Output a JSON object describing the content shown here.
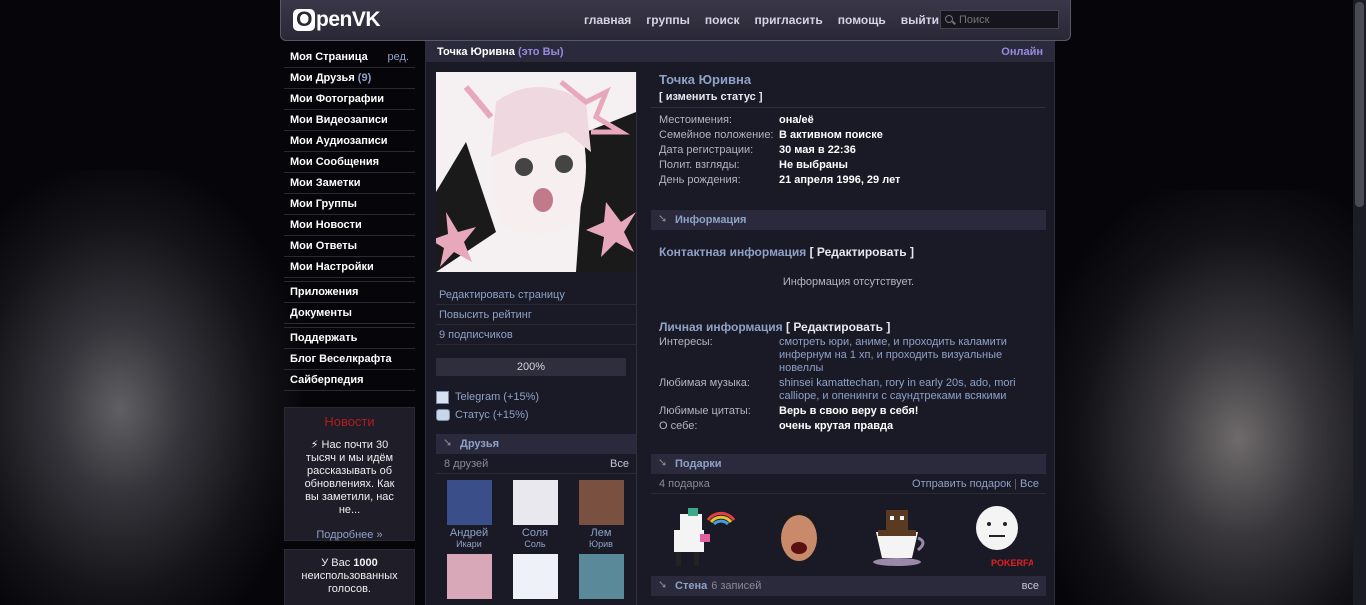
{
  "header": {
    "logo": "penVK",
    "logo_letter": "O",
    "nav": [
      "главная",
      "группы",
      "поиск",
      "пригласить",
      "помощь",
      "выйти"
    ],
    "search_placeholder": "Поиск"
  },
  "sidebar": {
    "items": [
      {
        "label": "Моя Страница",
        "extra": "ред."
      },
      {
        "label": "Мои Друзья",
        "count": "(9)"
      },
      {
        "label": "Мои Фотографии"
      },
      {
        "label": "Мои Видеозаписи"
      },
      {
        "label": "Мои Аудиозаписи"
      },
      {
        "label": "Мои Сообщения"
      },
      {
        "label": "Мои Заметки"
      },
      {
        "label": "Мои Группы"
      },
      {
        "label": "Мои Новости"
      },
      {
        "label": "Мои Ответы"
      },
      {
        "label": "Мои Настройки"
      }
    ],
    "items2": [
      "Приложения",
      "Документы"
    ],
    "items3": [
      "Поддержать",
      "Блог Веселкрафта",
      "Сайберпедия"
    ],
    "news": {
      "title": "Новости",
      "text": "⚡ Нас почти 30 тысяч и мы идём рассказывать об обновлениях. Как вы заметили, нас не...",
      "more": "Подробнее »"
    },
    "votes": {
      "prefix": "У Вас",
      "count": "1000",
      "suffix": "неиспользованных голосов."
    }
  },
  "profile": {
    "top_name": "Точка Юривна",
    "top_you": "(это Вы)",
    "online": "Онлайн",
    "name": "Точка Юривна",
    "status": "[ изменить статус ]",
    "info": [
      {
        "k": "Местоимения:",
        "v": "она/её"
      },
      {
        "k": "Семейное положение:",
        "v": "В активном поиске"
      },
      {
        "k": "Дата регистрации:",
        "v": "30 мая в 22:36"
      },
      {
        "k": "Полит. взгляды:",
        "v": "Не выбраны"
      },
      {
        "k": "День рождения:",
        "v": "21 апреля 1996, 29 лет"
      }
    ],
    "actions": [
      "Редактировать страницу",
      "Повысить рейтинг",
      "9 подписчиков"
    ],
    "rating": "200%",
    "links": [
      "Telegram (+15%)",
      "Статус (+15%)"
    ]
  },
  "friends": {
    "title": "Друзья",
    "count": "8 друзей",
    "all": "Все",
    "list": [
      {
        "first": "Андрей",
        "last": "Икари",
        "color": "#3a4e8a"
      },
      {
        "first": "Соля",
        "last": "Соль",
        "color": "#e8e8ee"
      },
      {
        "first": "Лем",
        "last": "Юрив",
        "color": "#7a5040"
      },
      {
        "first": "",
        "last": "",
        "color": "#d8a8b8"
      },
      {
        "first": "",
        "last": "",
        "color": "#eef2f8"
      },
      {
        "first": "",
        "last": "",
        "color": "#5a8a9a"
      }
    ]
  },
  "information": {
    "header": "Информация",
    "contact_title": "Контактная информация",
    "contact_edit": "[ Редактировать ]",
    "no_info": "Информация отсутствует.",
    "personal_title": "Личная информация",
    "personal_edit": "[ Редактировать ]",
    "personal": [
      {
        "k": "Интересы:",
        "v": "смотреть юри, аниме, и проходить каламити инфернум на 1 хп, и проходить визуальные новеллы",
        "style": "plain"
      },
      {
        "k": "Любимая музыка:",
        "v": "shinsei kamattechan, rory in early 20s, ado, mori calliope, и опенинги с саундтреками всякими",
        "style": "link"
      },
      {
        "k": "Любимые цитаты:",
        "v": "Верь в свою веру в себя!",
        "style": "bold"
      },
      {
        "k": "О себе:",
        "v": "очень крутая правда",
        "style": "bold"
      }
    ]
  },
  "gifts": {
    "header": "Подарки",
    "count": "4 подарка",
    "send": "Отправить подарок",
    "all": "Все",
    "pokerface": "POKERFACE"
  },
  "wall": {
    "header": "Стена",
    "count": "6 записей",
    "all": "все"
  }
}
